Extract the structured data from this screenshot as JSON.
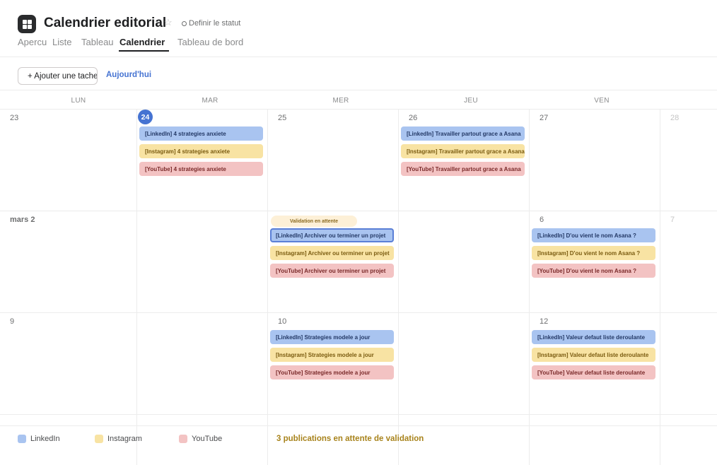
{
  "header": {
    "title": "Calendrier editorial",
    "star_icon": "☆",
    "status_label": "Definir le statut"
  },
  "tabs": [
    "Apercu",
    "Liste",
    "Tableau",
    "Calendrier",
    "Tableau de bord"
  ],
  "active_tab": "Calendrier",
  "toolbar": {
    "add_task": "+ Ajouter une tache",
    "today": "Aujourd'hui"
  },
  "calendar": {
    "weekdays": [
      "LUN",
      "MAR",
      "MER",
      "JEU",
      "VEN"
    ],
    "weeks": [
      {
        "days": [
          "23",
          "24",
          "25",
          "26",
          "27",
          "28"
        ]
      },
      {
        "days": [
          "mars 2",
          "",
          "",
          "",
          "6",
          "7"
        ]
      },
      {
        "days": [
          "9",
          "",
          "10",
          "",
          "12",
          ""
        ]
      }
    ],
    "events": {
      "tue24": [
        "[LinkedIn] 4 strategies anxiete",
        "[Instagram] 4 strategies anxiete",
        "[YouTube] 4 strategies anxiete"
      ],
      "thu26": [
        "[LinkedIn] Travailler partout grace a Asana",
        "[Instagram] Travailler partout grace a Asana",
        "[YouTube] Travailler partout grace a Asana"
      ],
      "wed4": [
        "[LinkedIn] Archiver ou terminer un projet",
        "[Instagram] Archiver ou terminer un projet",
        "[YouTube] Archiver ou terminer un projet"
      ],
      "fri6": [
        "[LinkedIn] D'ou vient le nom Asana ?",
        "[Instagram] D'ou vient le nom Asana ?",
        "[YouTube] D'ou vient le nom Asana ?"
      ],
      "wed10": [
        "[LinkedIn] Strategies modele a jour",
        "[Instagram] Strategies modele a jour",
        "[YouTube] Strategies modele a jour"
      ],
      "fri12": [
        "[LinkedIn] Valeur defaut liste deroulante",
        "[Instagram] Valeur defaut liste deroulante",
        "[YouTube] Valeur defaut liste deroulante"
      ]
    },
    "pending_pill": "Validation en attente"
  },
  "legend": {
    "items": [
      {
        "label": "LinkedIn",
        "color": "#a9c4f0"
      },
      {
        "label": "Instagram",
        "color": "#f8e3a3"
      },
      {
        "label": "YouTube",
        "color": "#f3c3c3"
      }
    ],
    "pending_text": "3 publications en attente de validation"
  },
  "colors": {
    "accent": "#4573d2",
    "linkedin": "#a9c4f0",
    "instagram": "#f8e3a3",
    "youtube": "#f3c3c3"
  }
}
